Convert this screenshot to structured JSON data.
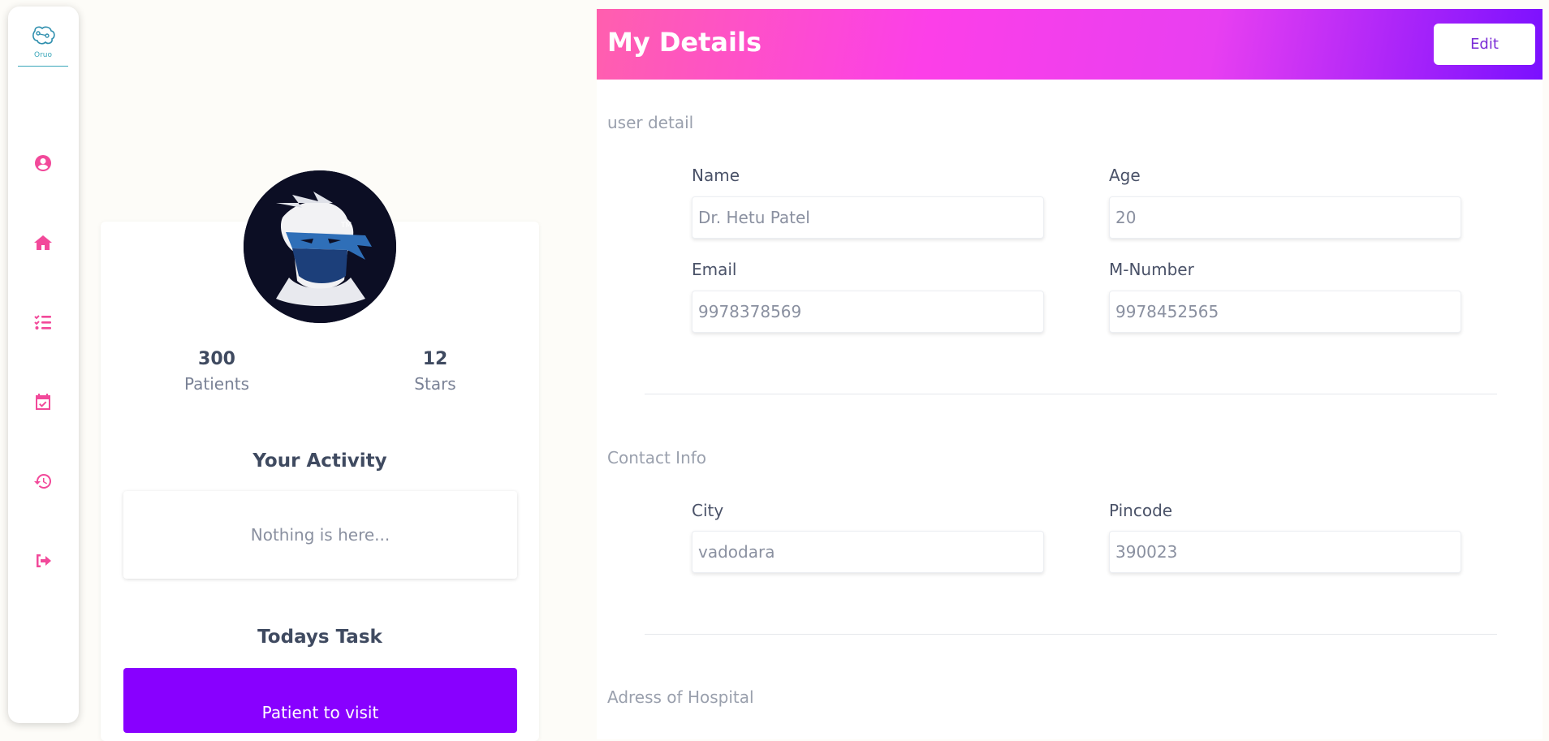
{
  "sidebar": {
    "logo_text": "Oruo",
    "items": [
      {
        "icon": "user-circle-icon",
        "label": "profile"
      },
      {
        "icon": "home-icon",
        "label": "home"
      },
      {
        "icon": "task-list-icon",
        "label": "tasks"
      },
      {
        "icon": "calendar-check-icon",
        "label": "appointments"
      },
      {
        "icon": "history-icon",
        "label": "history"
      },
      {
        "icon": "logout-icon",
        "label": "logout"
      }
    ],
    "accent_color": "#f2499a"
  },
  "profile": {
    "stats": [
      {
        "value": "300",
        "label": "Patients"
      },
      {
        "value": "12",
        "label": "Stars"
      }
    ],
    "activity_title": "Your Activity",
    "activity_empty": "Nothing is here...",
    "task_title": "Todays Task",
    "task_button": "Patient to visit"
  },
  "details": {
    "title": "My Details",
    "edit_label": "Edit",
    "sections": {
      "user": {
        "label": "user detail",
        "name_label": "Name",
        "name_value": "Dr. Hetu Patel",
        "age_label": "Age",
        "age_value": "20",
        "email_label": "Email",
        "email_value": "9978378569",
        "mnumber_label": "M-Number",
        "mnumber_value": "9978452565"
      },
      "contact": {
        "label": "Contact Info",
        "city_label": "City",
        "city_value": "vadodara",
        "pincode_label": "Pincode",
        "pincode_value": "390023"
      },
      "hospital": {
        "label": "Adress of Hospital"
      }
    }
  },
  "colors": {
    "header_gradient_start": "#ff5fae",
    "header_gradient_end": "#7a10ff",
    "task_button": "#8800ff"
  }
}
